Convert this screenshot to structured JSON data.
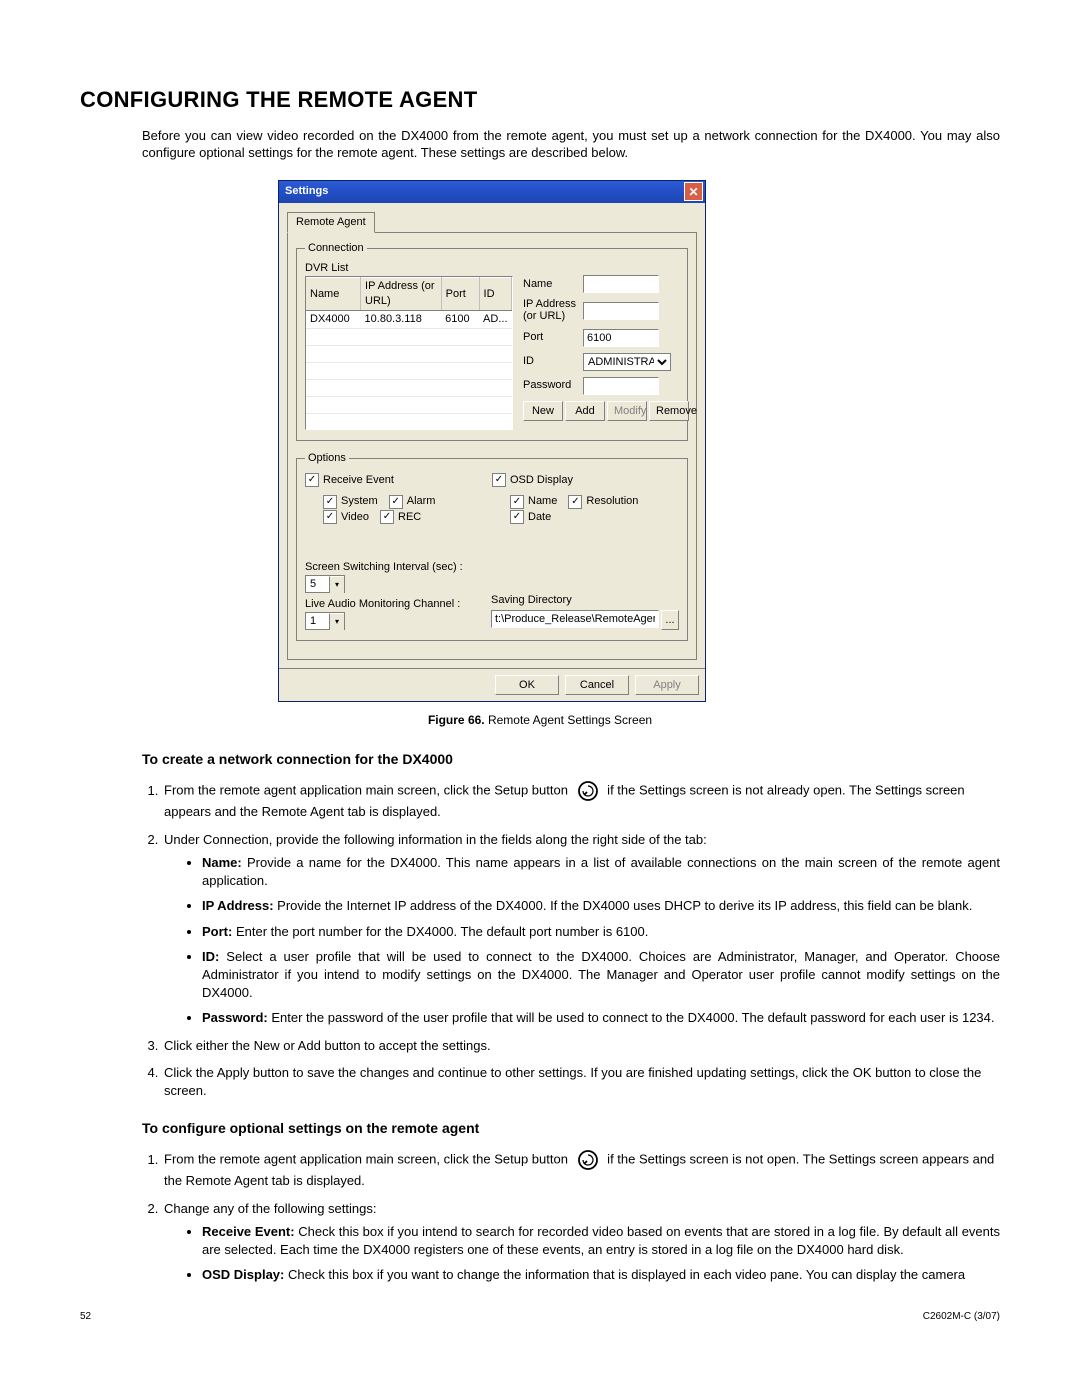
{
  "heading": "CONFIGURING THE REMOTE AGENT",
  "intro": "Before you can view video recorded on the DX4000 from the remote agent, you must set up a network connection for the DX4000. You may also configure optional settings for the remote agent. These settings are described below.",
  "dialog": {
    "title": "Settings",
    "tab": "Remote Agent",
    "connection": {
      "legend": "Connection",
      "listLabel": "DVR List",
      "columns": {
        "name": "Name",
        "ip": "IP Address (or URL)",
        "port": "Port",
        "id": "ID"
      },
      "row": {
        "name": "DX4000",
        "ip": "10.80.3.118",
        "port": "6100",
        "id": "AD..."
      },
      "fields": {
        "name": "Name",
        "ip": "IP Address (or URL)",
        "port": "Port",
        "portValue": "6100",
        "id": "ID",
        "idValue": "ADMINISTRATO",
        "password": "Password"
      },
      "buttons": {
        "new": "New",
        "add": "Add",
        "modify": "Modify",
        "remove": "Remove"
      }
    },
    "options": {
      "legend": "Options",
      "receiveEvent": "Receive Event",
      "system": "System",
      "alarm": "Alarm",
      "video": "Video",
      "rec": "REC",
      "osd": "OSD Display",
      "name": "Name",
      "resolution": "Resolution",
      "date": "Date",
      "switch": "Screen Switching Interval (sec) :",
      "switchVal": "5",
      "audio": "Live Audio Monitoring Channel :",
      "audioVal": "1",
      "savedir": "Saving Directory",
      "savedirVal": "t:\\Produce_Release\\RemoteAgent_ST",
      "browse": "..."
    },
    "bottom": {
      "ok": "OK",
      "cancel": "Cancel",
      "apply": "Apply"
    }
  },
  "caption": {
    "prefix": "Figure 66.",
    "text": "  Remote Agent Settings Screen"
  },
  "section1": {
    "title": "To create a network connection for the DX4000",
    "step1a": "From the remote agent application main screen, click the Setup button ",
    "step1b": " if the Settings screen is not already open. The Settings screen appears and the Remote Agent tab is displayed.",
    "step2": "Under Connection, provide the following information in the fields along the right side of the tab:",
    "nameB": "Name:",
    "nameT": " Provide a name for the DX4000. This name appears in a list of available connections on the main screen of the remote agent application.",
    "ipB": "IP Address:",
    "ipT": " Provide the Internet IP address of the DX4000. If the DX4000 uses DHCP to derive its IP address, this field can be blank.",
    "portB": "Port:",
    "portT": " Enter the port number for the DX4000. The default port number is 6100.",
    "idB": "ID:",
    "idT": " Select a user profile that will be used to connect to the DX4000. Choices are Administrator, Manager, and Operator. Choose Administrator if you intend to modify settings on the DX4000. The Manager and Operator user profile cannot modify settings on the DX4000.",
    "pwB": "Password:",
    "pwT": " Enter the password of the user profile that will be used to connect to the DX4000. The default password for each user is 1234.",
    "step3": "Click either the New or Add button to accept the settings.",
    "step4": "Click the Apply button to save the changes and continue to other settings. If you are finished updating settings, click the OK button to close the screen."
  },
  "section2": {
    "title": "To configure optional settings on the remote agent",
    "step1a": "From the remote agent application main screen, click the Setup button ",
    "step1b": " if the Settings screen is not open. The Settings screen appears and the Remote Agent tab is displayed.",
    "step2": "Change any of the following settings:",
    "reB": "Receive Event:",
    "reT": " Check this box if you intend to search for recorded video based on events that are stored in a log file. By default all events are selected. Each time the DX4000 registers one of these events, an entry is stored in a log file on the DX4000 hard disk.",
    "osdB": "OSD Display:",
    "osdT": " Check this box if you want to change the information that is displayed in each video pane. You can display the camera"
  },
  "footer": {
    "left": "52",
    "right": "C2602M-C (3/07)"
  }
}
